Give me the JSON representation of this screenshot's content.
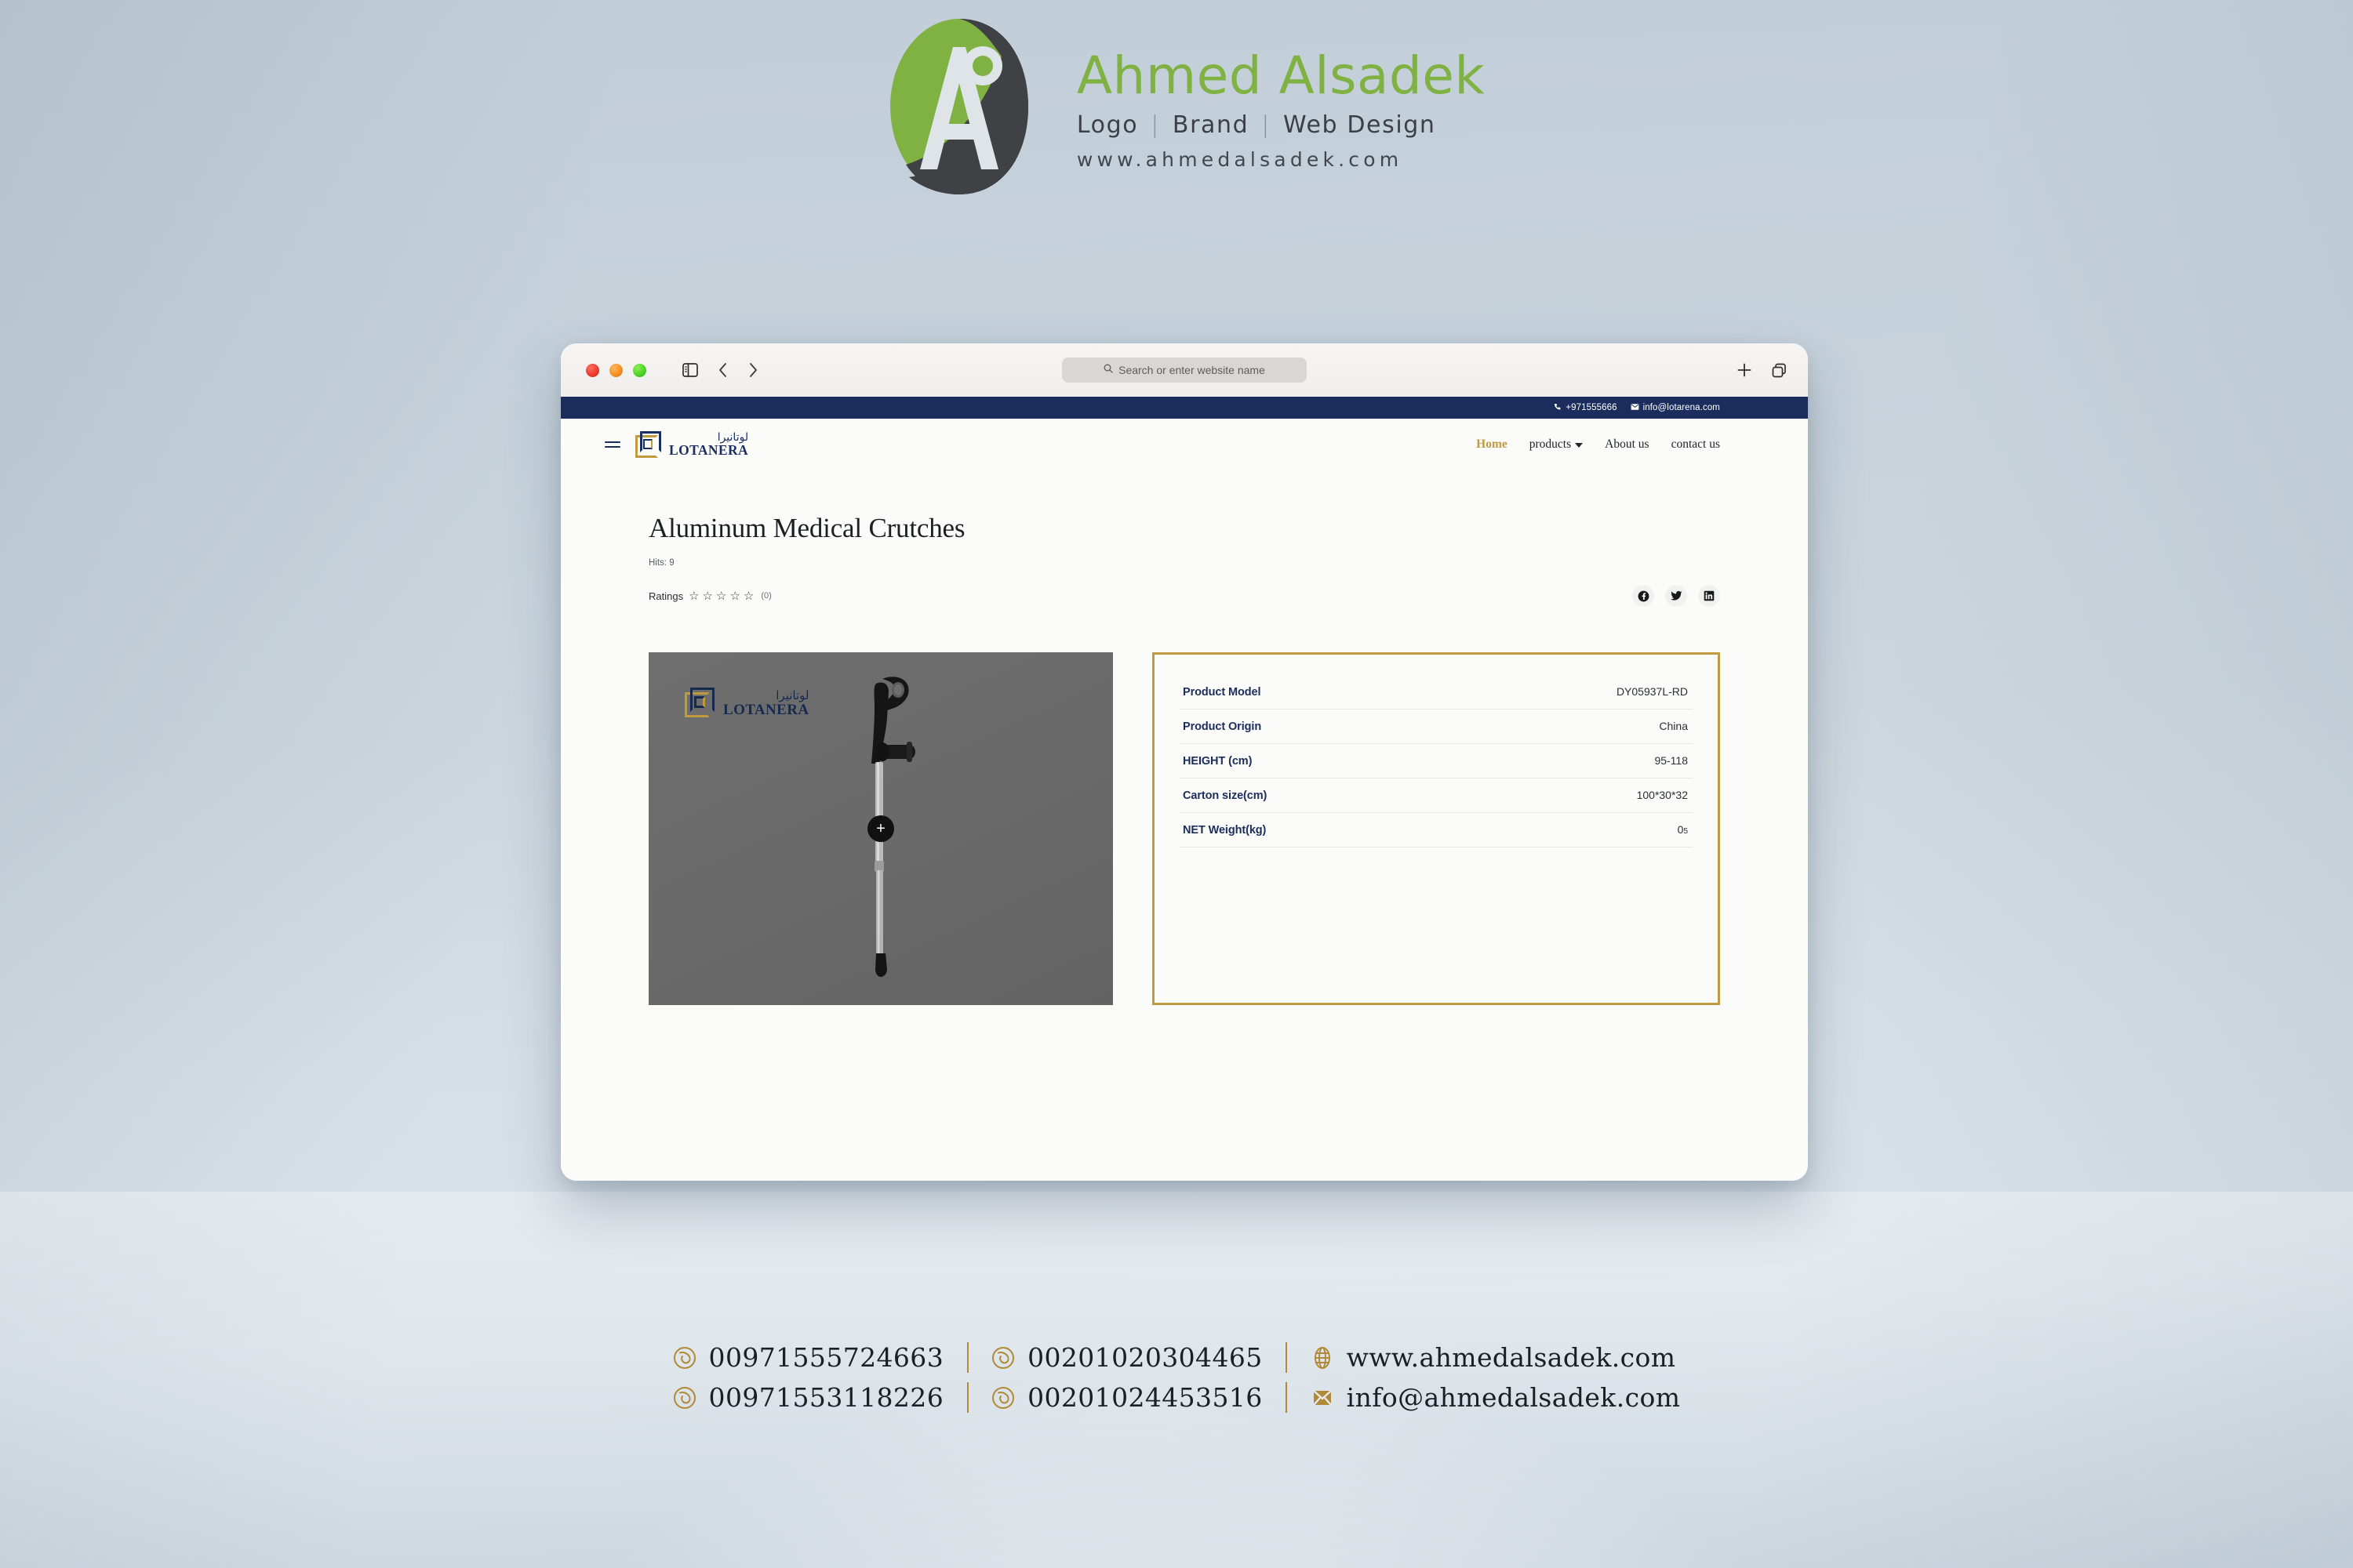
{
  "brand": {
    "name": "Ahmed Alsadek",
    "tagline": [
      "Logo",
      "Brand",
      "Web Design"
    ],
    "separator": "|",
    "url": "www.ahmedalsadek.com",
    "green": "#7fb243",
    "dark": "#3c3f45"
  },
  "browser": {
    "search_placeholder": "Search or enter website name",
    "icons": {
      "sidebar": "sidebar-icon",
      "back": "back-chevron-icon",
      "forward": "forward-chevron-icon",
      "search": "search-icon",
      "new_tab": "plus-icon",
      "tab_overview": "tab-overview-icon"
    }
  },
  "site": {
    "topbar": {
      "phone": "+971555666",
      "email": "info@lotarena.com",
      "bg": "#1b2d5c"
    },
    "logo": {
      "arabic": "لوتانيرا",
      "latin": "LOTANERA",
      "navy": "#1b3060",
      "gold": "#c09a3e"
    },
    "nav": [
      {
        "label": "Home",
        "active": true,
        "has_dropdown": false
      },
      {
        "label": "products",
        "active": false,
        "has_dropdown": true
      },
      {
        "label": "About us",
        "active": false,
        "has_dropdown": false
      },
      {
        "label": "contact us",
        "active": false,
        "has_dropdown": false
      }
    ]
  },
  "product": {
    "title": "Aluminum Medical Crutches",
    "hits": "Hits: 9",
    "ratings_label": "Ratings",
    "rating_stars": "☆☆☆☆☆",
    "rating_count": "(0)",
    "socials": [
      "facebook-icon",
      "twitter-icon",
      "linkedin-icon"
    ],
    "image": {
      "watermark_arabic": "لوتانيرا",
      "watermark_latin": "LOTANERA",
      "zoom_label": "+",
      "alt": "aluminum forearm crutch on gray background"
    },
    "specs": [
      {
        "label": "Product Model",
        "value": "DY05937L-RD"
      },
      {
        "label": "Product Origin",
        "value": "China"
      },
      {
        "label": "HEIGHT (cm)",
        "value": "95-118"
      },
      {
        "label": "Carton size(cm)",
        "value": "100*30*32"
      },
      {
        "label": "NET Weight(kg)",
        "value_main": "0",
        "value_sub": "5"
      }
    ],
    "panel_border": "#c09a3e"
  },
  "footer": {
    "gold": "#b08a36",
    "contacts": [
      {
        "icon": "phone-icon",
        "text": "00971555724663"
      },
      {
        "icon": "phone-icon",
        "text": "00201020304465"
      },
      {
        "icon": "globe-icon",
        "text": "www.ahmedalsadek.com"
      },
      {
        "icon": "phone-icon",
        "text": "00971553118226"
      },
      {
        "icon": "phone-icon",
        "text": "00201024453516"
      },
      {
        "icon": "mail-icon",
        "text": "info@ahmedalsadek.com"
      }
    ]
  }
}
